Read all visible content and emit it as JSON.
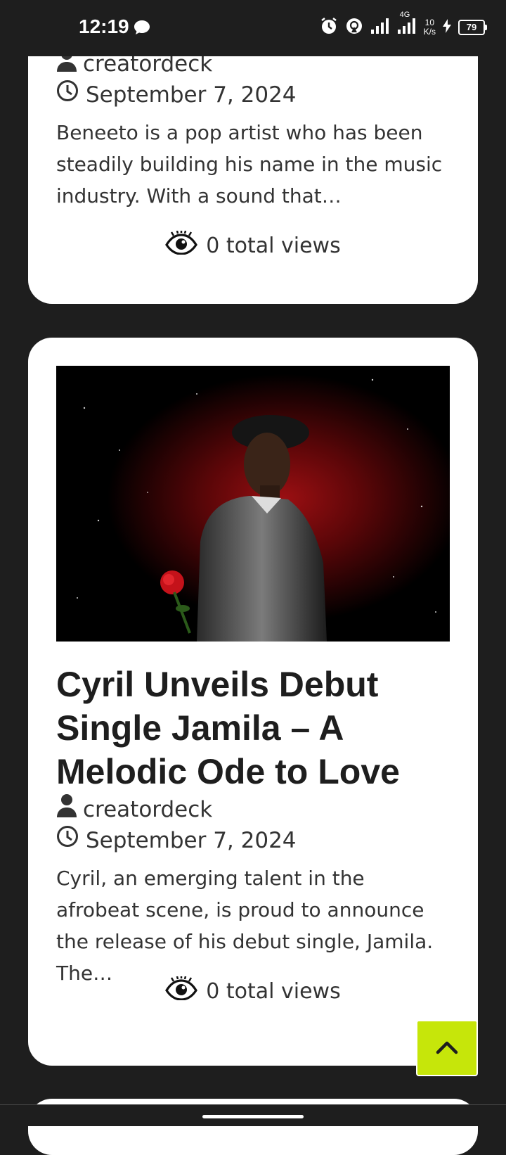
{
  "status_bar": {
    "time": "12:19",
    "network_rate_top": "10",
    "network_rate_bottom": "K/s",
    "network_type": "4G",
    "battery": "79"
  },
  "posts": [
    {
      "author": "creatordeck",
      "date": "September 7, 2024",
      "excerpt": "Beneeto is a pop artist who has been steadily building his name in the music industry. With a sound that…",
      "views": "0 total views"
    },
    {
      "title": "Cyril Unveils Debut Single Jamila – A Melodic Ode to Love",
      "author": "creatordeck",
      "date": "September 7, 2024",
      "excerpt": " Cyril, an emerging talent in the afrobeat scene, is proud to announce the release of his debut single, Jamila. The…",
      "views": "0 total views"
    }
  ],
  "colors": {
    "background": "#1e1e1e",
    "card": "#ffffff",
    "accent": "#c6e60a"
  },
  "icons": {
    "author": "user-icon",
    "date": "clock-icon",
    "views": "eye-icon",
    "scroll_top": "chevron-up-icon"
  }
}
